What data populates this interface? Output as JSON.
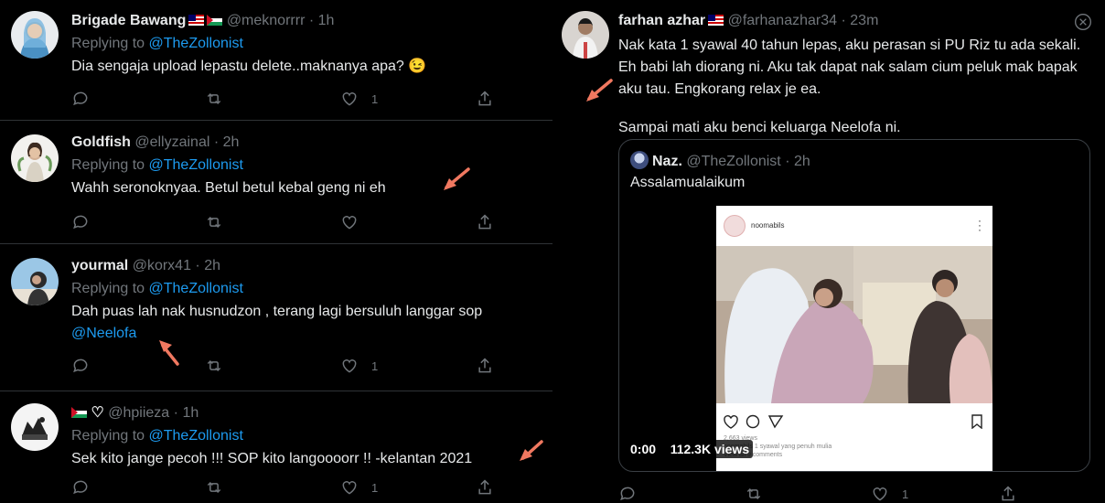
{
  "left_tweets": [
    {
      "name": "Brigade Bawang",
      "flags": [
        "malaysia-flag",
        "palestine-flag"
      ],
      "handle": "@meknorrrr",
      "time": "1h",
      "replying_prefix": "Replying to",
      "replying_to": "@TheZollonist",
      "text": "Dia sengaja upload lepastu delete..maknanya apa? 😉",
      "like_count": "1"
    },
    {
      "name": "Goldfish",
      "handle": "@ellyzainal",
      "time": "2h",
      "replying_prefix": "Replying to",
      "replying_to": "@TheZollonist",
      "text": "Wahh seronoknyaa. Betul betul kebal geng ni eh",
      "like_count": ""
    },
    {
      "name": "yourmal",
      "handle": "@korx41",
      "time": "2h",
      "replying_prefix": "Replying to",
      "replying_to": "@TheZollonist",
      "text": "Dah puas lah nak husnudzon , terang lagi bersuluh langgar sop",
      "text_mention": "@Neelofa",
      "like_count": "1"
    },
    {
      "name": "🇵🇸♡",
      "handle": "@hpiieza",
      "time": "1h",
      "replying_prefix": "Replying to",
      "replying_to": "@TheZollonist",
      "text": "Sek kito jange pecoh !!! SOP kito langoooorr !! -kelantan 2021",
      "like_count": "1"
    }
  ],
  "separator": "·",
  "right_tweet": {
    "name": "farhan azhar",
    "flag": "malaysia-flag",
    "handle": "@farhanazhar34",
    "time": "23m",
    "line1": "Nak kata 1 syawal 40 tahun lepas, aku perasan si PU Riz tu ada sekali.",
    "line2": "Eh babi lah diorang ni. Aku tak dapat nak salam cium peluk mak bapak",
    "line3": "aku tau. Engkorang relax je ea.",
    "line4": "Sampai mati aku benci keluarga Neelofa ni.",
    "like_count": "1",
    "quote": {
      "name": "Naz.",
      "handle": "@TheZollonist",
      "time": "2h",
      "text": "Assalamualaikum",
      "media": {
        "ig_username": "noomabils",
        "ig_likes": "2,663 views",
        "ig_caption": "noomabils 1 syawal yang penuh mulia",
        "ig_comments": "View all 9 comments",
        "timestamp": "0:00",
        "views": "112.3K views"
      }
    }
  },
  "colors": {
    "background": "#000000",
    "text": "#e7e9ea",
    "muted": "#71767b",
    "link": "#1d9bf0",
    "divider": "#2f3336",
    "annotation_arrow": "#f07860"
  }
}
